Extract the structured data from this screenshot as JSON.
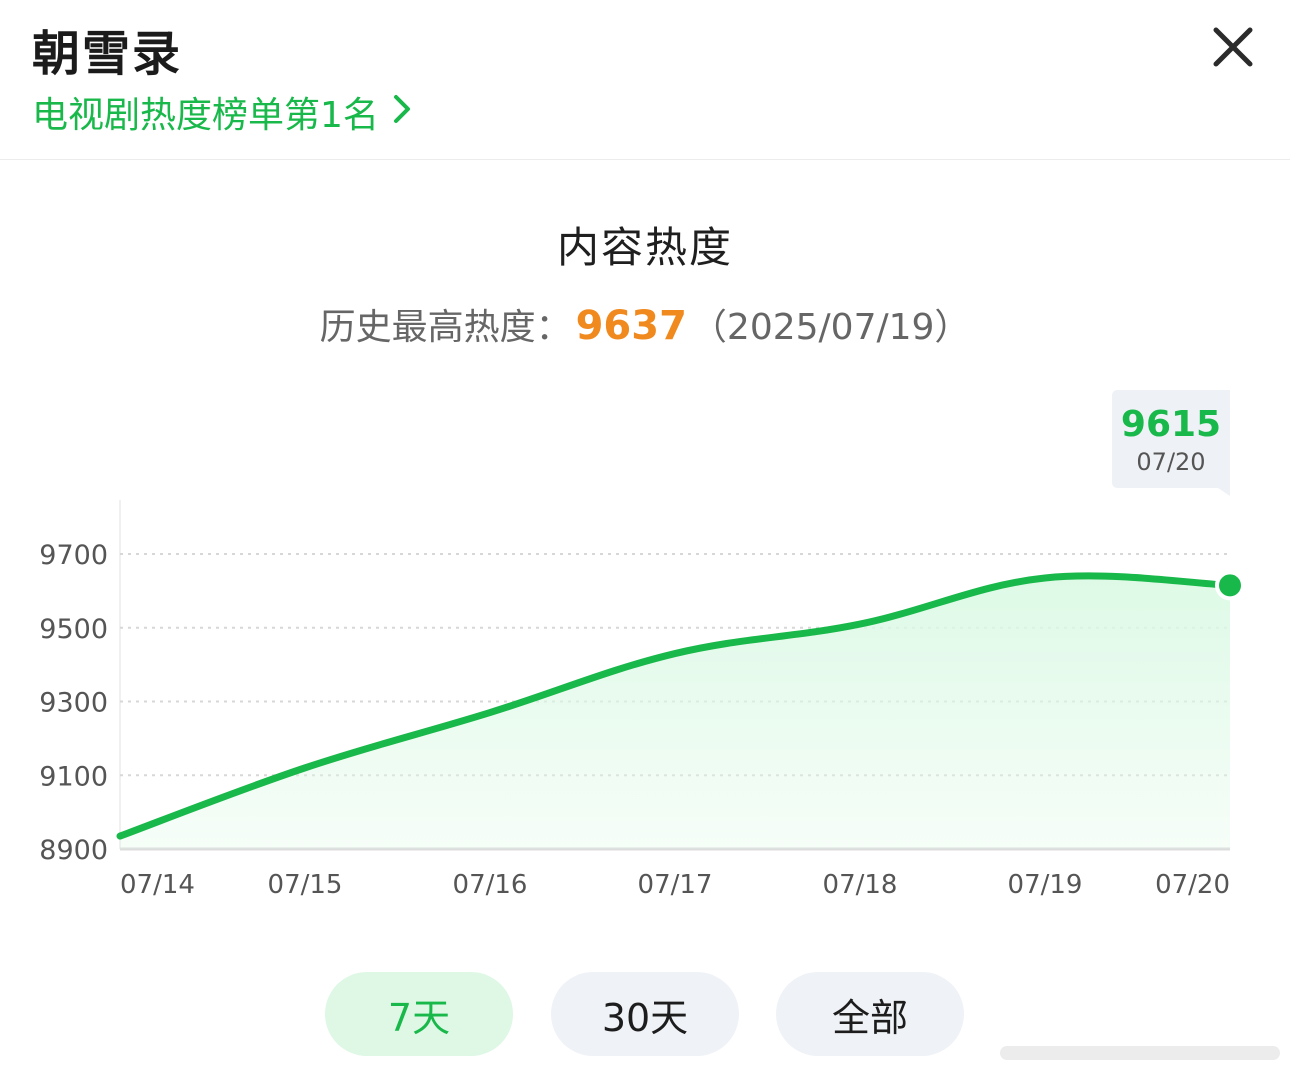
{
  "header": {
    "title": "朝雪录",
    "rank_text": "电视剧热度榜单第1名",
    "close_icon": "close-icon",
    "chevron_icon": "chevron-right-icon"
  },
  "colors": {
    "accent": "#19b84a",
    "record": "#f08a1e",
    "fill": "#dcf9e5",
    "grid": "#d7d7d7"
  },
  "record": {
    "label": "历史最高热度：",
    "value": "9637",
    "date": "（2025/07/19）"
  },
  "tooltip": {
    "value": "9615",
    "date": "07/20"
  },
  "tabs": [
    {
      "label": "7天",
      "active": true
    },
    {
      "label": "30天",
      "active": false
    },
    {
      "label": "全部",
      "active": false
    }
  ],
  "chart_data": {
    "type": "area",
    "title": "内容热度",
    "xlabel": "",
    "ylabel": "",
    "categories": [
      "07/14",
      "07/15",
      "07/16",
      "07/17",
      "07/18",
      "07/19",
      "07/20"
    ],
    "values": [
      8935,
      9120,
      9270,
      9430,
      9510,
      9635,
      9615
    ],
    "yticks": [
      8900,
      9100,
      9300,
      9500,
      9700
    ],
    "ylim": [
      8900,
      9700
    ],
    "grid": true,
    "highlight_index": 6
  }
}
